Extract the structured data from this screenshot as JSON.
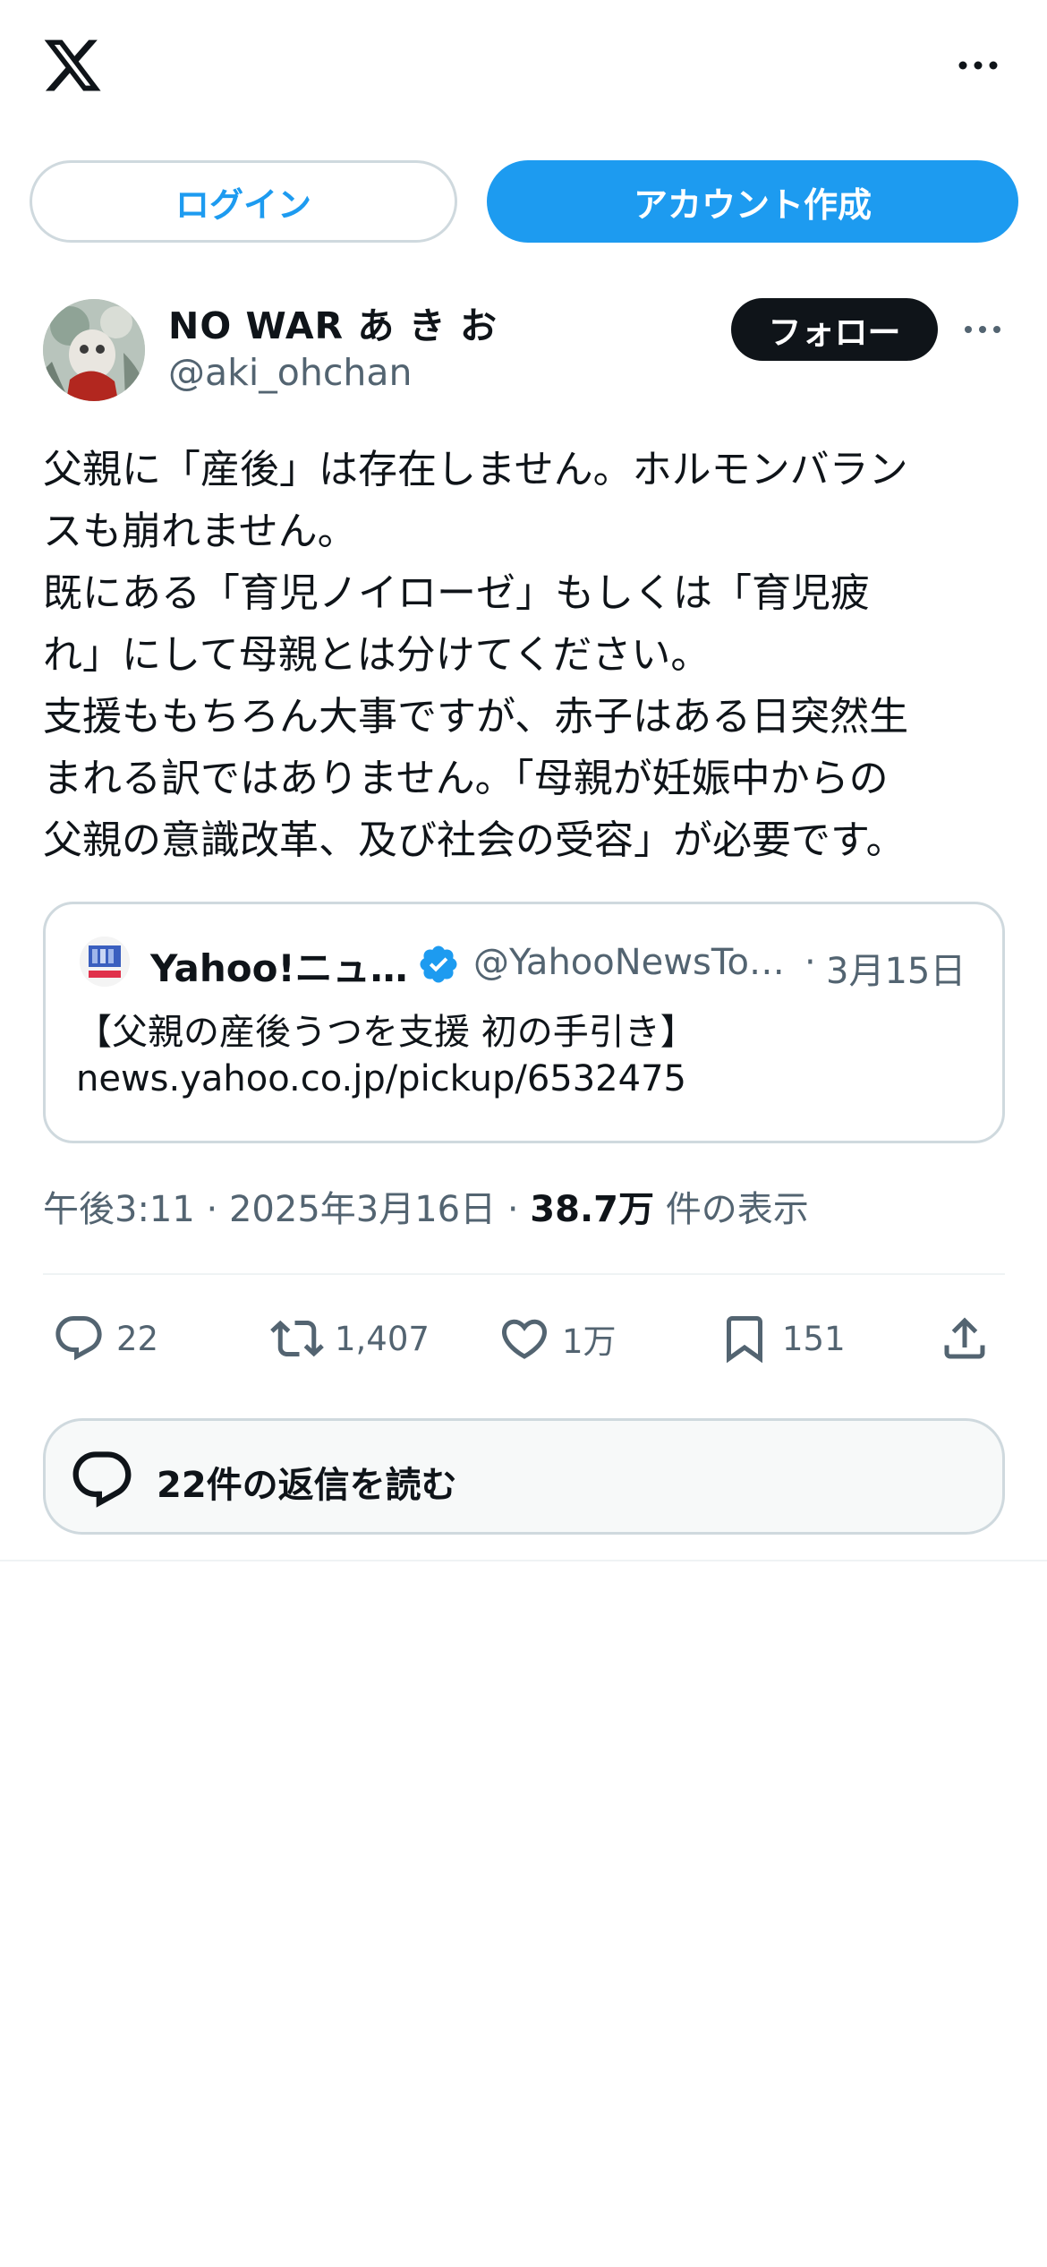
{
  "header": {
    "logo_icon": "x-logo-icon",
    "more_icon": "more-horizontal-icon"
  },
  "auth": {
    "login_label": "ログイン",
    "signup_label": "アカウント作成"
  },
  "post": {
    "author_name": "NO WAR あ き お",
    "author_handle": "@aki_ohchan",
    "follow_label": "フォロー",
    "text": "父親に「産後」は存在しません。ホルモンバラン\nスも崩れません。\n既にある「育児ノイローゼ」もしくは「育児疲\nれ」にして母親とは分けてください。\n支援ももちろん大事ですが、赤子はある日突然生\nまれる訳ではありません。「母親が妊娠中からの\n父親の意識改革、及び社会の受容」が必要です。",
    "quote": {
      "name": "Yahoo!ニュ…",
      "handle": "@YahooNewsTo…",
      "dot": "·",
      "date": "3月15日",
      "line1": "【父親の産後うつを支援 初の手引き】",
      "line2": "news.yahoo.co.jp/pickup/6532475"
    },
    "meta": {
      "time": "午後3:11",
      "sep1": " · ",
      "date": "2025年3月16日",
      "sep2": " · ",
      "views_count": "38.7万",
      "views_label": " 件の表示"
    },
    "actions": {
      "replies": "22",
      "reposts": "1,407",
      "likes": "1万",
      "bookmarks": "151"
    },
    "read_replies_label": "22件の返信を読む"
  },
  "colors": {
    "accent": "#1d9bf0",
    "text": "#0f1419",
    "secondary": "#536471",
    "border": "#cfd9de"
  }
}
